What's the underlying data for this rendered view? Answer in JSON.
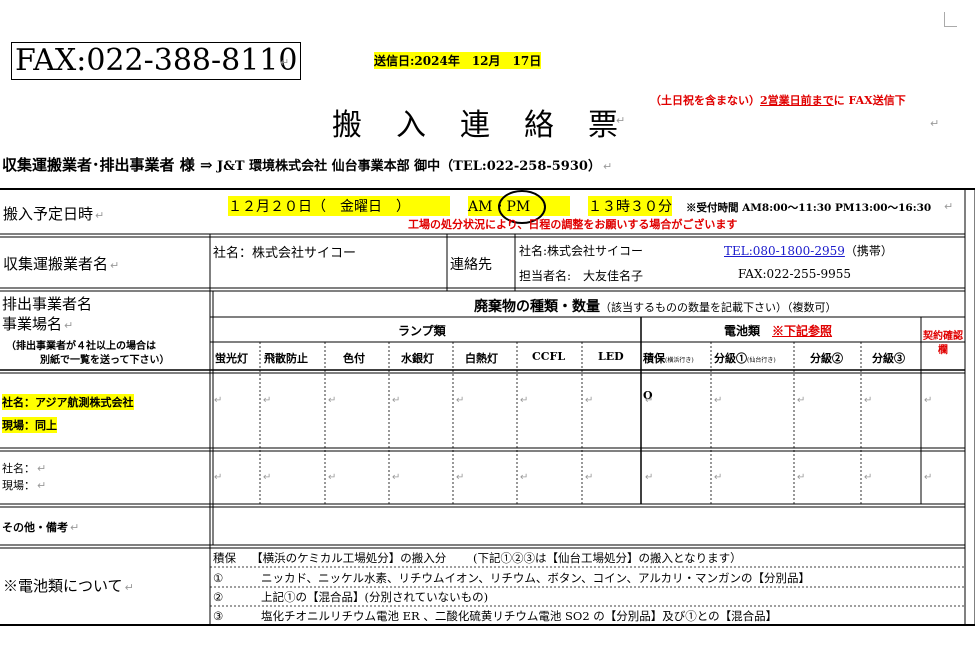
{
  "header": {
    "fax": "FAX:022-388-8110",
    "send_date": "送信日:2024年　12月　17日",
    "title": "搬　入　連　絡　票",
    "note_prefix": "（土日祝を含まない）",
    "note_underlined": "2営業日前まで",
    "note_suffix": "に FAX送信下",
    "recipient_label": "収集運搬業者･排出事業者 様 ⇒",
    "recipient_company": " J&T 環境株式会社 仙台事業本部 御中（TEL:022-258-5930）"
  },
  "schedule": {
    "label": "搬入予定日時",
    "date": "１２月２０日（　金曜日　）",
    "am_pm": "AM・PM",
    "time": "１３時３０分",
    "reception_hours": "※受付時間 AM8:00～11:30 PM13:00～16:30",
    "notice": "工場の処分状況により、日程の調整をお願いする場合がございます"
  },
  "transporter": {
    "label": "収集運搬業者名",
    "company": "社名：株式会社サイコー",
    "contact_label": "連絡先",
    "contact_company": "社名:株式会社サイコー",
    "tel": "TEL:080-1800-2959",
    "tel_suffix": "（携帯）",
    "person": "担当者名:　大友佳名子",
    "fax": "FAX:022-255-9955"
  },
  "discharger": {
    "label1": "排出事業者名",
    "label2": "事業場名",
    "note1": "（排出事業者が４社以上の場合は",
    "note2": "別紙で一覧を送って下さい）"
  },
  "waste": {
    "heading": "廃棄物の種類・数量",
    "heading_note": "（該当するものの数量を記載下さい）（複数可）",
    "lamp_group": "ランプ類",
    "battery_group": "電池類",
    "battery_note": "※下記参照",
    "contract_check": "契約確認欄",
    "columns": [
      "蛍光灯",
      "飛散防止",
      "色付",
      "水銀灯",
      "白熱灯",
      "CCFL",
      "LED",
      "積保",
      "分級①",
      "分級②",
      "分級③"
    ],
    "col_sub_sekiho": "(横浜行き)",
    "col_sub_bunkyu1": "(仙台行き)"
  },
  "entries": [
    {
      "company": "社名：アジア航測株式会社",
      "site": "現場：同上",
      "sekiho": "O"
    },
    {
      "company": "社名：",
      "site": "現場：",
      "sekiho": ""
    }
  ],
  "other": {
    "label": "その他・備考"
  },
  "battery_notes": {
    "label": "※電池類について",
    "line0": "積保　 【横浜のケミカル工場処分】の搬入分　　 (下記①②③は【仙台工場処分】の搬入となります）",
    "items": [
      {
        "num": "①",
        "text": "ニッカド、ニッケル水素、リチウムイオン、リチウム、ボタン、コイン、アルカリ・マンガンの【分別品】"
      },
      {
        "num": "②",
        "text": "上記①の【混合品】(分別されていないもの)"
      },
      {
        "num": "③",
        "text": "塩化チオニルリチウム電池 ER 、二酸化硫黄リチウム電池 SO2 の【分別品】及び①との【混合品】"
      }
    ]
  },
  "colors": {
    "highlight": "#ffff00",
    "alert_red": "#e00000",
    "link_blue": "#1a1acc"
  }
}
